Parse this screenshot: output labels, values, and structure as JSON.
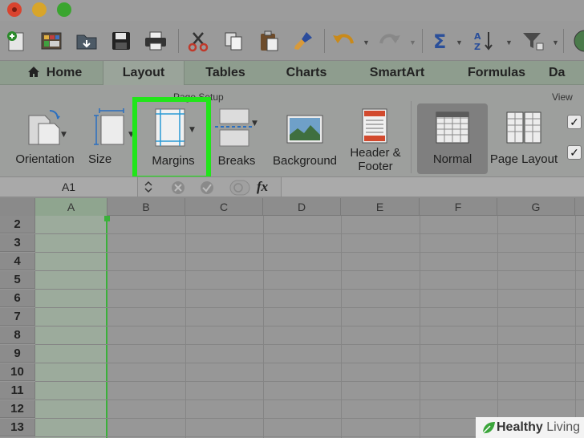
{
  "toolbar": {
    "icons": [
      "new-icon",
      "gallery-icon",
      "open-icon",
      "save-icon",
      "print-icon",
      "cut-icon",
      "copy-icon",
      "paste-icon",
      "format-brush-icon",
      "undo-icon",
      "redo-icon",
      "autosum-icon",
      "sort-icon",
      "filter-icon"
    ]
  },
  "tabs": [
    {
      "label": "Home"
    },
    {
      "label": "Layout"
    },
    {
      "label": "Tables"
    },
    {
      "label": "Charts"
    },
    {
      "label": "SmartArt"
    },
    {
      "label": "Formulas"
    },
    {
      "label": "Da"
    }
  ],
  "active_tab": "Layout",
  "ribbon": {
    "page_setup_label": "Page Setup",
    "view_label": "View",
    "buttons": {
      "orientation": "Orientation",
      "size": "Size",
      "margins": "Margins",
      "breaks": "Breaks",
      "background": "Background",
      "header_footer_1": "Header &",
      "header_footer_2": "Footer",
      "normal": "Normal",
      "page_layout": "Page Layout"
    },
    "checkbox_glyph": "✓"
  },
  "formula_bar": {
    "name_box": "A1",
    "fx_label": "fx",
    "formula": ""
  },
  "grid": {
    "columns": [
      "A",
      "B",
      "C",
      "D",
      "E",
      "F",
      "G"
    ],
    "selected_column": "A",
    "rows": [
      "2",
      "3",
      "4",
      "5",
      "6",
      "7",
      "8",
      "9",
      "10",
      "11",
      "12",
      "13"
    ]
  },
  "watermark": {
    "brand_bold": "Healthy",
    "brand_rest": " Living"
  },
  "colors": {
    "highlight": "#21e51a",
    "selection": "#3ab13a",
    "close_button": "#d9432e",
    "minimize_button": "#d8a52a",
    "zoom_button": "#3aa52f"
  }
}
